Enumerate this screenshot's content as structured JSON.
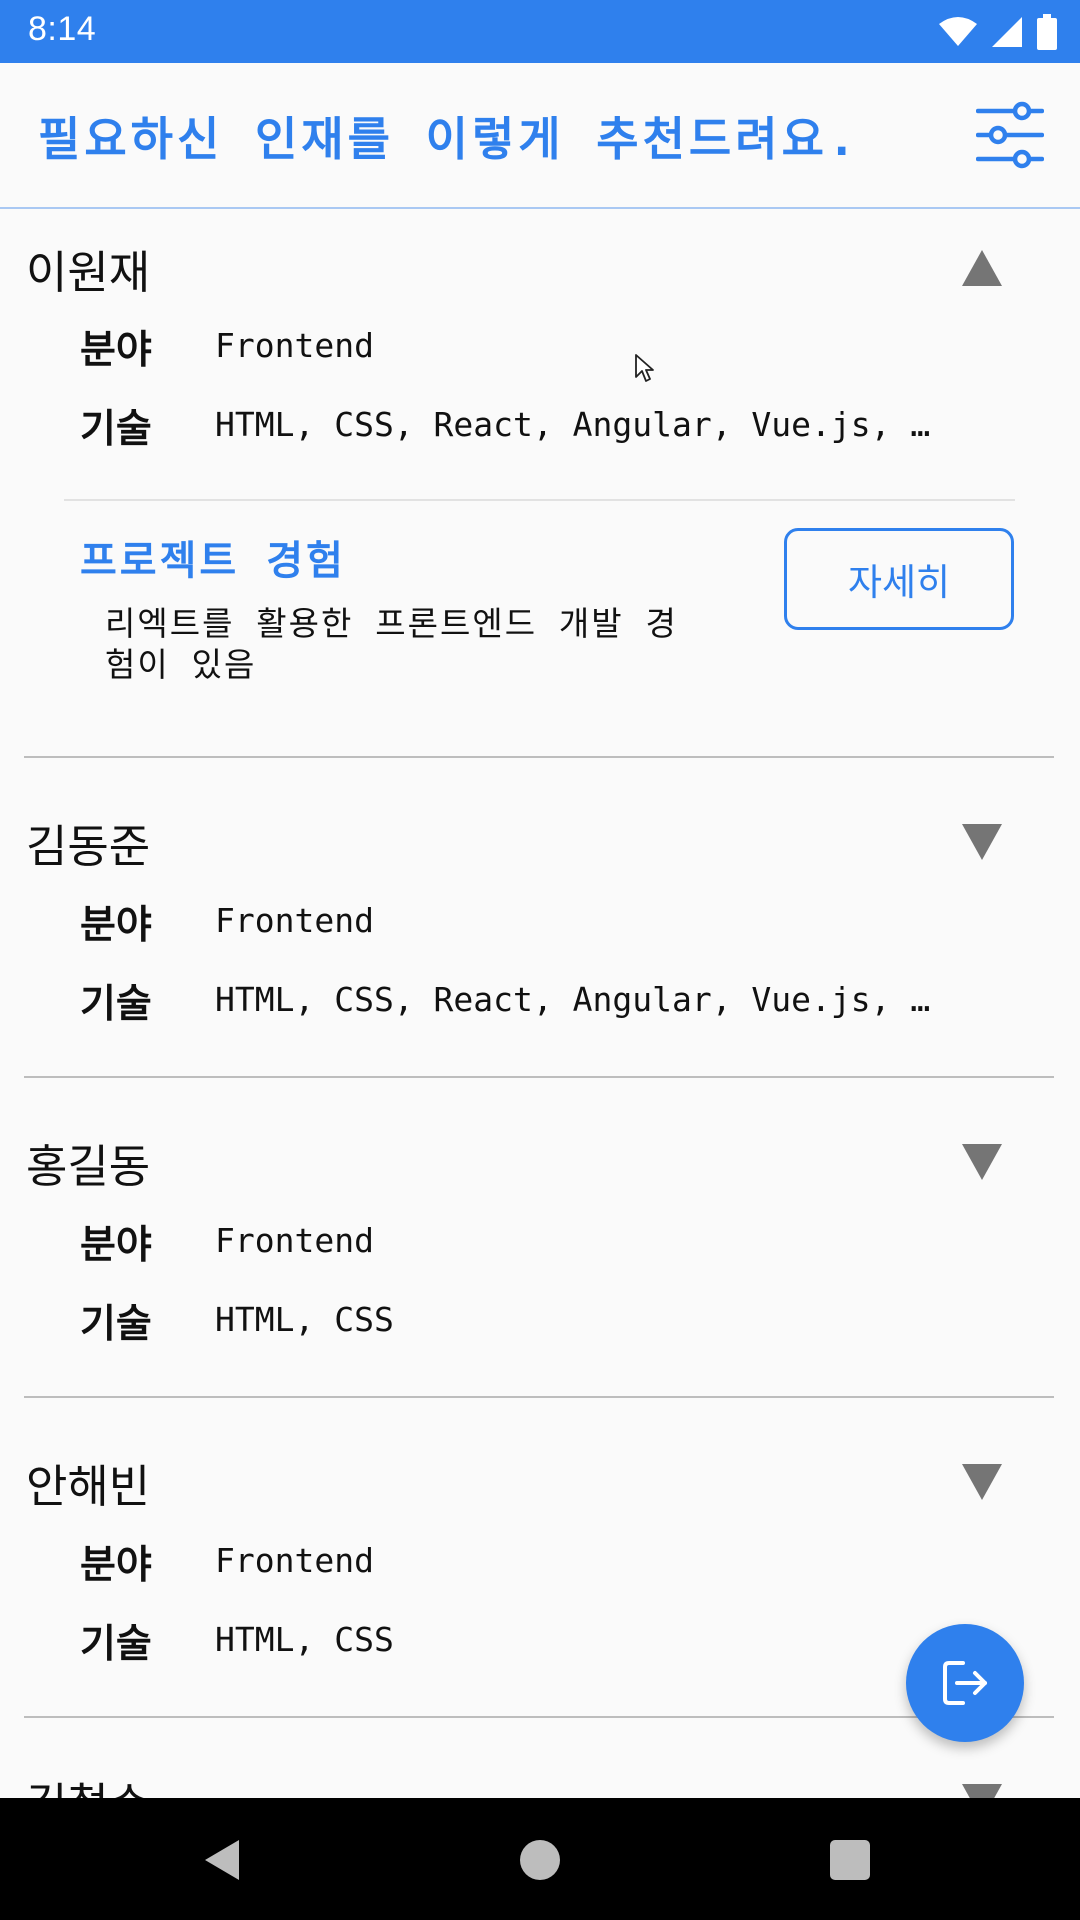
{
  "status_bar": {
    "time": "8:14",
    "icons": [
      "wifi-icon",
      "cell-signal-icon",
      "battery-icon"
    ]
  },
  "header": {
    "title": "필요하신 인재를 이렇게 추천드려요.",
    "filter_icon": "sliders-icon"
  },
  "candidates": [
    {
      "name": "이원재",
      "expanded": true,
      "field_label": "분야",
      "field_value": "Frontend",
      "skills_label": "기술",
      "skills_value": "HTML, CSS, React, Angular, Vue.js, …",
      "project_title": "프로젝트 경험",
      "project_desc": "리엑트를 활용한 프론트엔드 개발 경험이 있음",
      "detail_button": "자세히"
    },
    {
      "name": "김동준",
      "expanded": false,
      "field_label": "분야",
      "field_value": "Frontend",
      "skills_label": "기술",
      "skills_value": "HTML, CSS, React, Angular, Vue.js, …"
    },
    {
      "name": "홍길동",
      "expanded": false,
      "field_label": "분야",
      "field_value": "Frontend",
      "skills_label": "기술",
      "skills_value": "HTML, CSS"
    },
    {
      "name": "안해빈",
      "expanded": false,
      "field_label": "분야",
      "field_value": "Frontend",
      "skills_label": "기술",
      "skills_value": "HTML, CSS"
    },
    {
      "name": "김철수",
      "expanded": false
    }
  ],
  "fab": {
    "icon": "logout-icon"
  },
  "nav": {
    "back_icon": "back-icon",
    "home_icon": "home-icon",
    "recents_icon": "recents-icon"
  },
  "colors": {
    "primary": "#2f80ed",
    "background": "#fafafa",
    "divider": "#bdbdbd",
    "toggle": "#757575"
  }
}
